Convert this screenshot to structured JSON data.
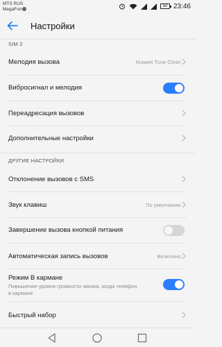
{
  "status": {
    "carrier1": "MTS RUS",
    "carrier2": "MegaFon",
    "battery": "50",
    "time": "23:46"
  },
  "toolbar": {
    "title": "Настройки"
  },
  "sections": {
    "sim2": "SIM 2",
    "other": "ДРУГИЕ НАСТРОЙКИ"
  },
  "rows": {
    "ringtone": {
      "label": "Мелодия вызова",
      "value": "Huawei Tune Clean"
    },
    "vibrate": {
      "label": "Вибросигнал и мелодия",
      "enabled": true
    },
    "forwarding": {
      "label": "Переадресация вызовов"
    },
    "additional": {
      "label": "Дополнительные настройки"
    },
    "reject_sms": {
      "label": "Отклонение вызовов с SMS"
    },
    "key_sound": {
      "label": "Звук клавиш",
      "value": "По умолчанию"
    },
    "power_end": {
      "label": "Завершение вызова кнопкой питания",
      "enabled": false
    },
    "auto_record": {
      "label": "Автоматическая запись вызовов",
      "value": "Включено"
    },
    "pocket": {
      "label": "Режим В кармане",
      "sub": "Повышение уровня громкости звонка, когда телефон в кармане",
      "enabled": true
    },
    "speed_dial": {
      "label": "Быстрый набор"
    }
  },
  "icons": {
    "back": "arrow-left-icon",
    "chevron": "chevron-right-icon",
    "nav_back": "triangle-back-icon",
    "nav_home": "circle-home-icon",
    "nav_recents": "square-recents-icon"
  },
  "colors": {
    "accent": "#2b7fff",
    "toggle_off": "#d6d6d6"
  }
}
